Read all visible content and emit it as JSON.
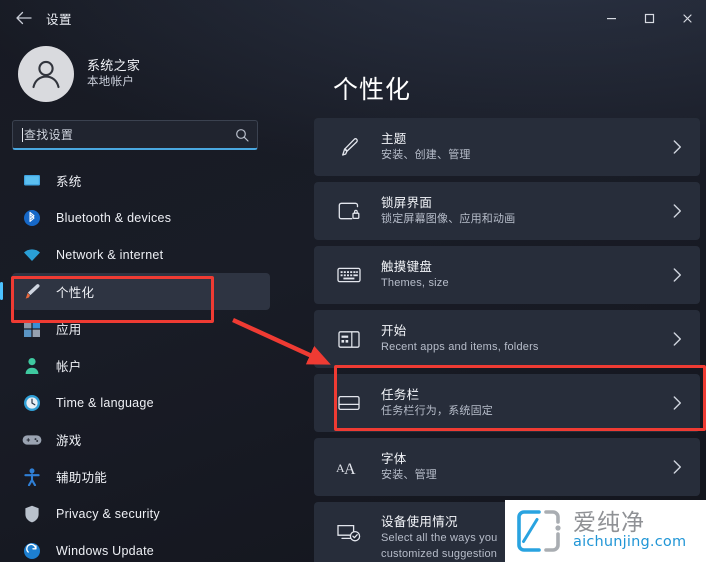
{
  "window": {
    "title": "设置",
    "back_icon": "back-arrow-icon",
    "controls": [
      {
        "name": "minimize-button",
        "icon": "minimize-icon",
        "label": "—"
      },
      {
        "name": "maximize-button",
        "icon": "maximize-icon",
        "label": "▢"
      },
      {
        "name": "close-button",
        "icon": "close-icon",
        "label": "✕"
      }
    ]
  },
  "account": {
    "name": "系统之家",
    "subtitle": "本地帐户",
    "avatar_icon": "user-avatar-icon"
  },
  "search": {
    "placeholder": "查找设置",
    "value": "",
    "icon": "search-icon"
  },
  "sidebar": {
    "items": [
      {
        "label": "系统",
        "icon": "system-monitor-icon",
        "selected": false
      },
      {
        "label": "Bluetooth & devices",
        "icon": "bluetooth-icon",
        "selected": false
      },
      {
        "label": "Network & internet",
        "icon": "wifi-icon",
        "selected": false
      },
      {
        "label": "个性化",
        "icon": "paintbrush-icon",
        "selected": true
      },
      {
        "label": "应用",
        "icon": "apps-icon",
        "selected": false
      },
      {
        "label": "帐户",
        "icon": "account-person-icon",
        "selected": false
      },
      {
        "label": "Time & language",
        "icon": "clock-icon",
        "selected": false
      },
      {
        "label": "游戏",
        "icon": "gamepad-icon",
        "selected": false
      },
      {
        "label": "辅助功能",
        "icon": "accessibility-icon",
        "selected": false
      },
      {
        "label": "Privacy & security",
        "icon": "shield-icon",
        "selected": false
      },
      {
        "label": "Windows Update",
        "icon": "update-refresh-icon",
        "selected": false
      }
    ]
  },
  "main": {
    "page_title": "个性化",
    "cards": [
      {
        "title": "主题",
        "subtitle": "安装、创建、管理",
        "subtitle2": "",
        "icon": "paintbrush-icon",
        "chevron": "chevron-right-icon",
        "highlighted": false
      },
      {
        "title": "锁屏界面",
        "subtitle": "锁定屏幕图像、应用和动画",
        "subtitle2": "",
        "icon": "lock-screen-icon",
        "chevron": "chevron-right-icon",
        "highlighted": false
      },
      {
        "title": "触摸键盘",
        "subtitle": "Themes, size",
        "subtitle2": "",
        "icon": "touch-keyboard-icon",
        "chevron": "chevron-right-icon",
        "highlighted": false
      },
      {
        "title": "开始",
        "subtitle": "Recent apps and items, folders",
        "subtitle2": "",
        "icon": "start-menu-icon",
        "chevron": "chevron-right-icon",
        "highlighted": false
      },
      {
        "title": "任务栏",
        "subtitle": "任务栏行为，系统固定",
        "subtitle2": "",
        "icon": "taskbar-icon",
        "chevron": "chevron-right-icon",
        "highlighted": true
      },
      {
        "title": "字体",
        "subtitle": "安装、管理",
        "subtitle2": "",
        "icon": "font-aa-icon",
        "chevron": "chevron-right-icon",
        "highlighted": false
      },
      {
        "title": "设备使用情况",
        "subtitle": "Select all the ways you",
        "subtitle2": "customized suggestion",
        "icon": "device-usage-icon",
        "chevron": "chevron-right-icon",
        "highlighted": false
      }
    ]
  },
  "annotations": {
    "box_color": "#ef3b33",
    "arrow": {
      "name": "red-pointer-arrow",
      "from": "个性化",
      "to": "任务栏"
    },
    "boxes": [
      {
        "name": "highlight-box-personalization",
        "target": "个性化"
      },
      {
        "name": "highlight-box-taskbar",
        "target": "任务栏"
      }
    ]
  },
  "watermark": {
    "brand_cn": "爱纯净",
    "brand_url": "aichunjing.com",
    "logo_icon": "aichunjing-logo-icon",
    "logo_color": "#29a3e0"
  }
}
